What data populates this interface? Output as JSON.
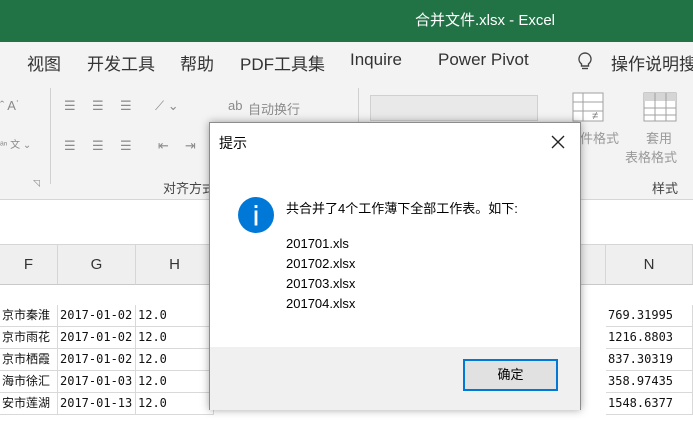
{
  "window": {
    "title": "合并文件.xlsx  -  Excel"
  },
  "menu": {
    "tabs": [
      "视图",
      "开发工具",
      "帮助",
      "PDF工具集",
      "Inquire",
      "Power Pivot"
    ],
    "search_label": "操作说明搜"
  },
  "ribbon": {
    "wrap_text": "自动换行",
    "alignment_group": "对齐方式",
    "cond_format_partial": "件格式",
    "table_format_line1": "套用",
    "table_format_line2": "表格格式",
    "styles_group": "样式"
  },
  "columns": {
    "headers": [
      "F",
      "G",
      "H",
      "N"
    ]
  },
  "rows": [
    {
      "f": "京市秦淮",
      "g": "2017-01-02",
      "h": "12.0",
      "n": "769.31995"
    },
    {
      "f": "京市雨花",
      "g": "2017-01-02",
      "h": "12.0",
      "n": "1216.8803"
    },
    {
      "f": "京市栖霞",
      "g": "2017-01-02",
      "h": "12.0",
      "n": "837.30319"
    },
    {
      "f": "海市徐汇",
      "g": "2017-01-03",
      "h": "12.0",
      "n": "358.97435"
    },
    {
      "f": "安市莲湖",
      "g": "2017-01-13",
      "h": "12.0",
      "n": "1548.6377"
    }
  ],
  "dialog": {
    "title": "提示",
    "message": "共合并了4个工作薄下全部工作表。如下:",
    "files": [
      "201701.xls",
      "201702.xlsx",
      "201703.xlsx",
      "201704.xlsx"
    ],
    "ok_label": "确定"
  },
  "colors": {
    "excel_green": "#217346",
    "accent_blue": "#0078d7"
  }
}
